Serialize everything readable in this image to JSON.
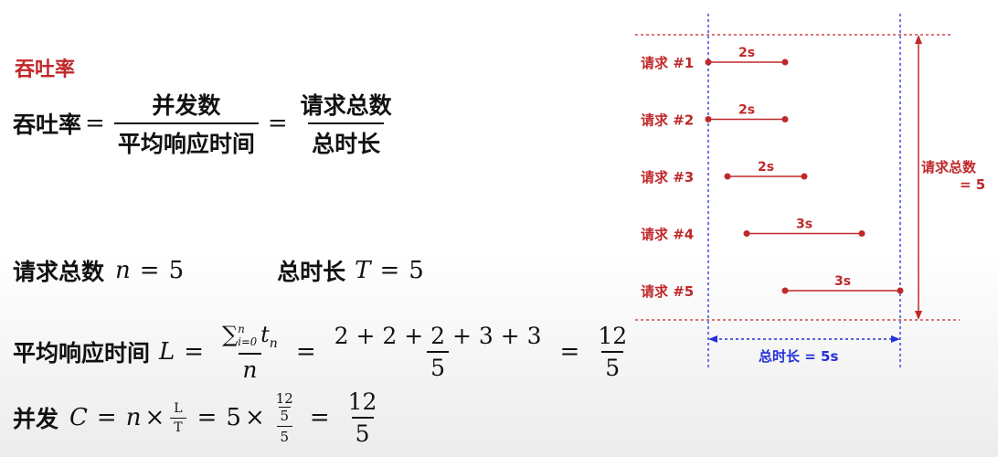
{
  "heading": "吞吐率",
  "formula1": {
    "lhs": "吞吐率",
    "eq": "=",
    "frac1_num": "并发数",
    "frac1_den": "平均响应时间",
    "frac2_num": "请求总数",
    "frac2_den": "总时长"
  },
  "formula2": {
    "label_n": "请求总数",
    "var_n": "n",
    "val_n": "5",
    "label_t": "总时长",
    "var_t": "T",
    "val_t": "5"
  },
  "formula3": {
    "label": "平均响应时间",
    "var": "L",
    "sum_num": "∑",
    "sum_sup": "n",
    "sum_sub": "i=0",
    "term": "t",
    "term_sub": "n",
    "den1": "n",
    "num2": "2 + 2 + 2 + 3 + 3",
    "den2": "5",
    "num3": "12",
    "den3": "5"
  },
  "formula4": {
    "label": "并发",
    "var_c": "C",
    "var_n": "n",
    "times": "×",
    "small_num": "L",
    "small_den": "T",
    "val5": "5",
    "inner_num": "12",
    "inner_den": "5",
    "inner_outer_den": "5",
    "final_num": "12",
    "final_den": "5"
  },
  "diagram": {
    "requests": [
      {
        "label": "请求 #1",
        "duration": "2s",
        "start": 0,
        "end": 2
      },
      {
        "label": "请求 #2",
        "duration": "2s",
        "start": 0,
        "end": 2
      },
      {
        "label": "请求 #3",
        "duration": "2s",
        "start": 0.5,
        "end": 2.5
      },
      {
        "label": "请求 #4",
        "duration": "3s",
        "start": 1,
        "end": 4
      },
      {
        "label": "请求 #5",
        "duration": "3s",
        "start": 2,
        "end": 5
      }
    ],
    "total_requests_label": "请求总数",
    "total_requests_value": "= 5",
    "total_time_label": "总时长 = 5s",
    "colors": {
      "request": "#c0282a",
      "time_axis": "#2430d8"
    }
  }
}
